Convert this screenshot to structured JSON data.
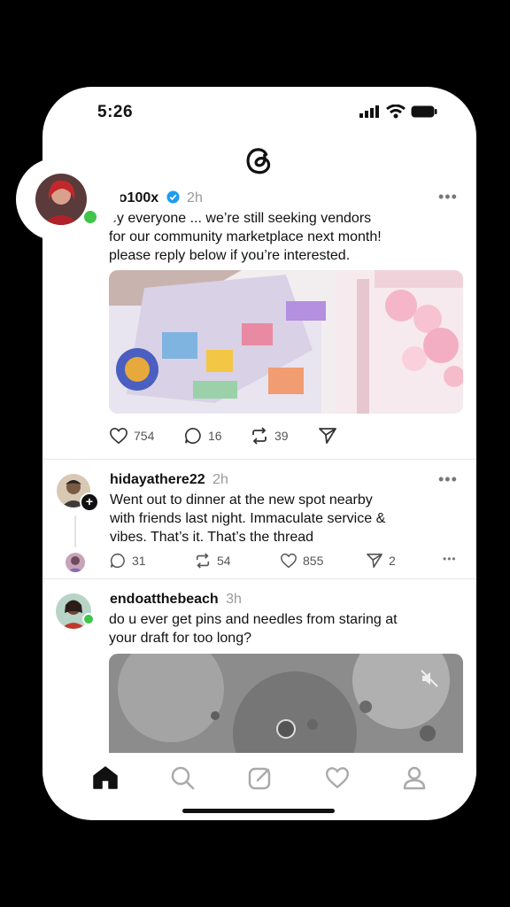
{
  "status": {
    "time": "5:26"
  },
  "posts": [
    {
      "username": "ho100x",
      "time": "2h",
      "verified": true,
      "text": "ey everyone ... we’re still seeking vendors\nfor our community marketplace next month!\nplease reply below if you’re interested.",
      "likes": "754",
      "replies": "16",
      "reposts": "39"
    },
    {
      "username": "hidayathere22",
      "time": "2h",
      "text": "Went out to dinner at the new spot nearby\nwith friends last night. Immaculate service &\nvibes. That’s it. That’s the thread",
      "replies": "31",
      "reposts": "54",
      "likes": "855",
      "shares": "2"
    },
    {
      "username": "endoatthebeach",
      "time": "3h",
      "text": "do u ever get pins and needles from staring at\nyour draft for too long?"
    }
  ],
  "colors": {
    "online": "#3ec54a",
    "verified": "#1d9bf0"
  },
  "icons": [
    "threads-logo-icon",
    "signal-icon",
    "wifi-icon",
    "battery-icon",
    "heart-icon",
    "comment-icon",
    "repost-icon",
    "share-icon",
    "mute-icon",
    "home-icon",
    "search-icon",
    "compose-icon",
    "activity-icon",
    "profile-icon"
  ]
}
